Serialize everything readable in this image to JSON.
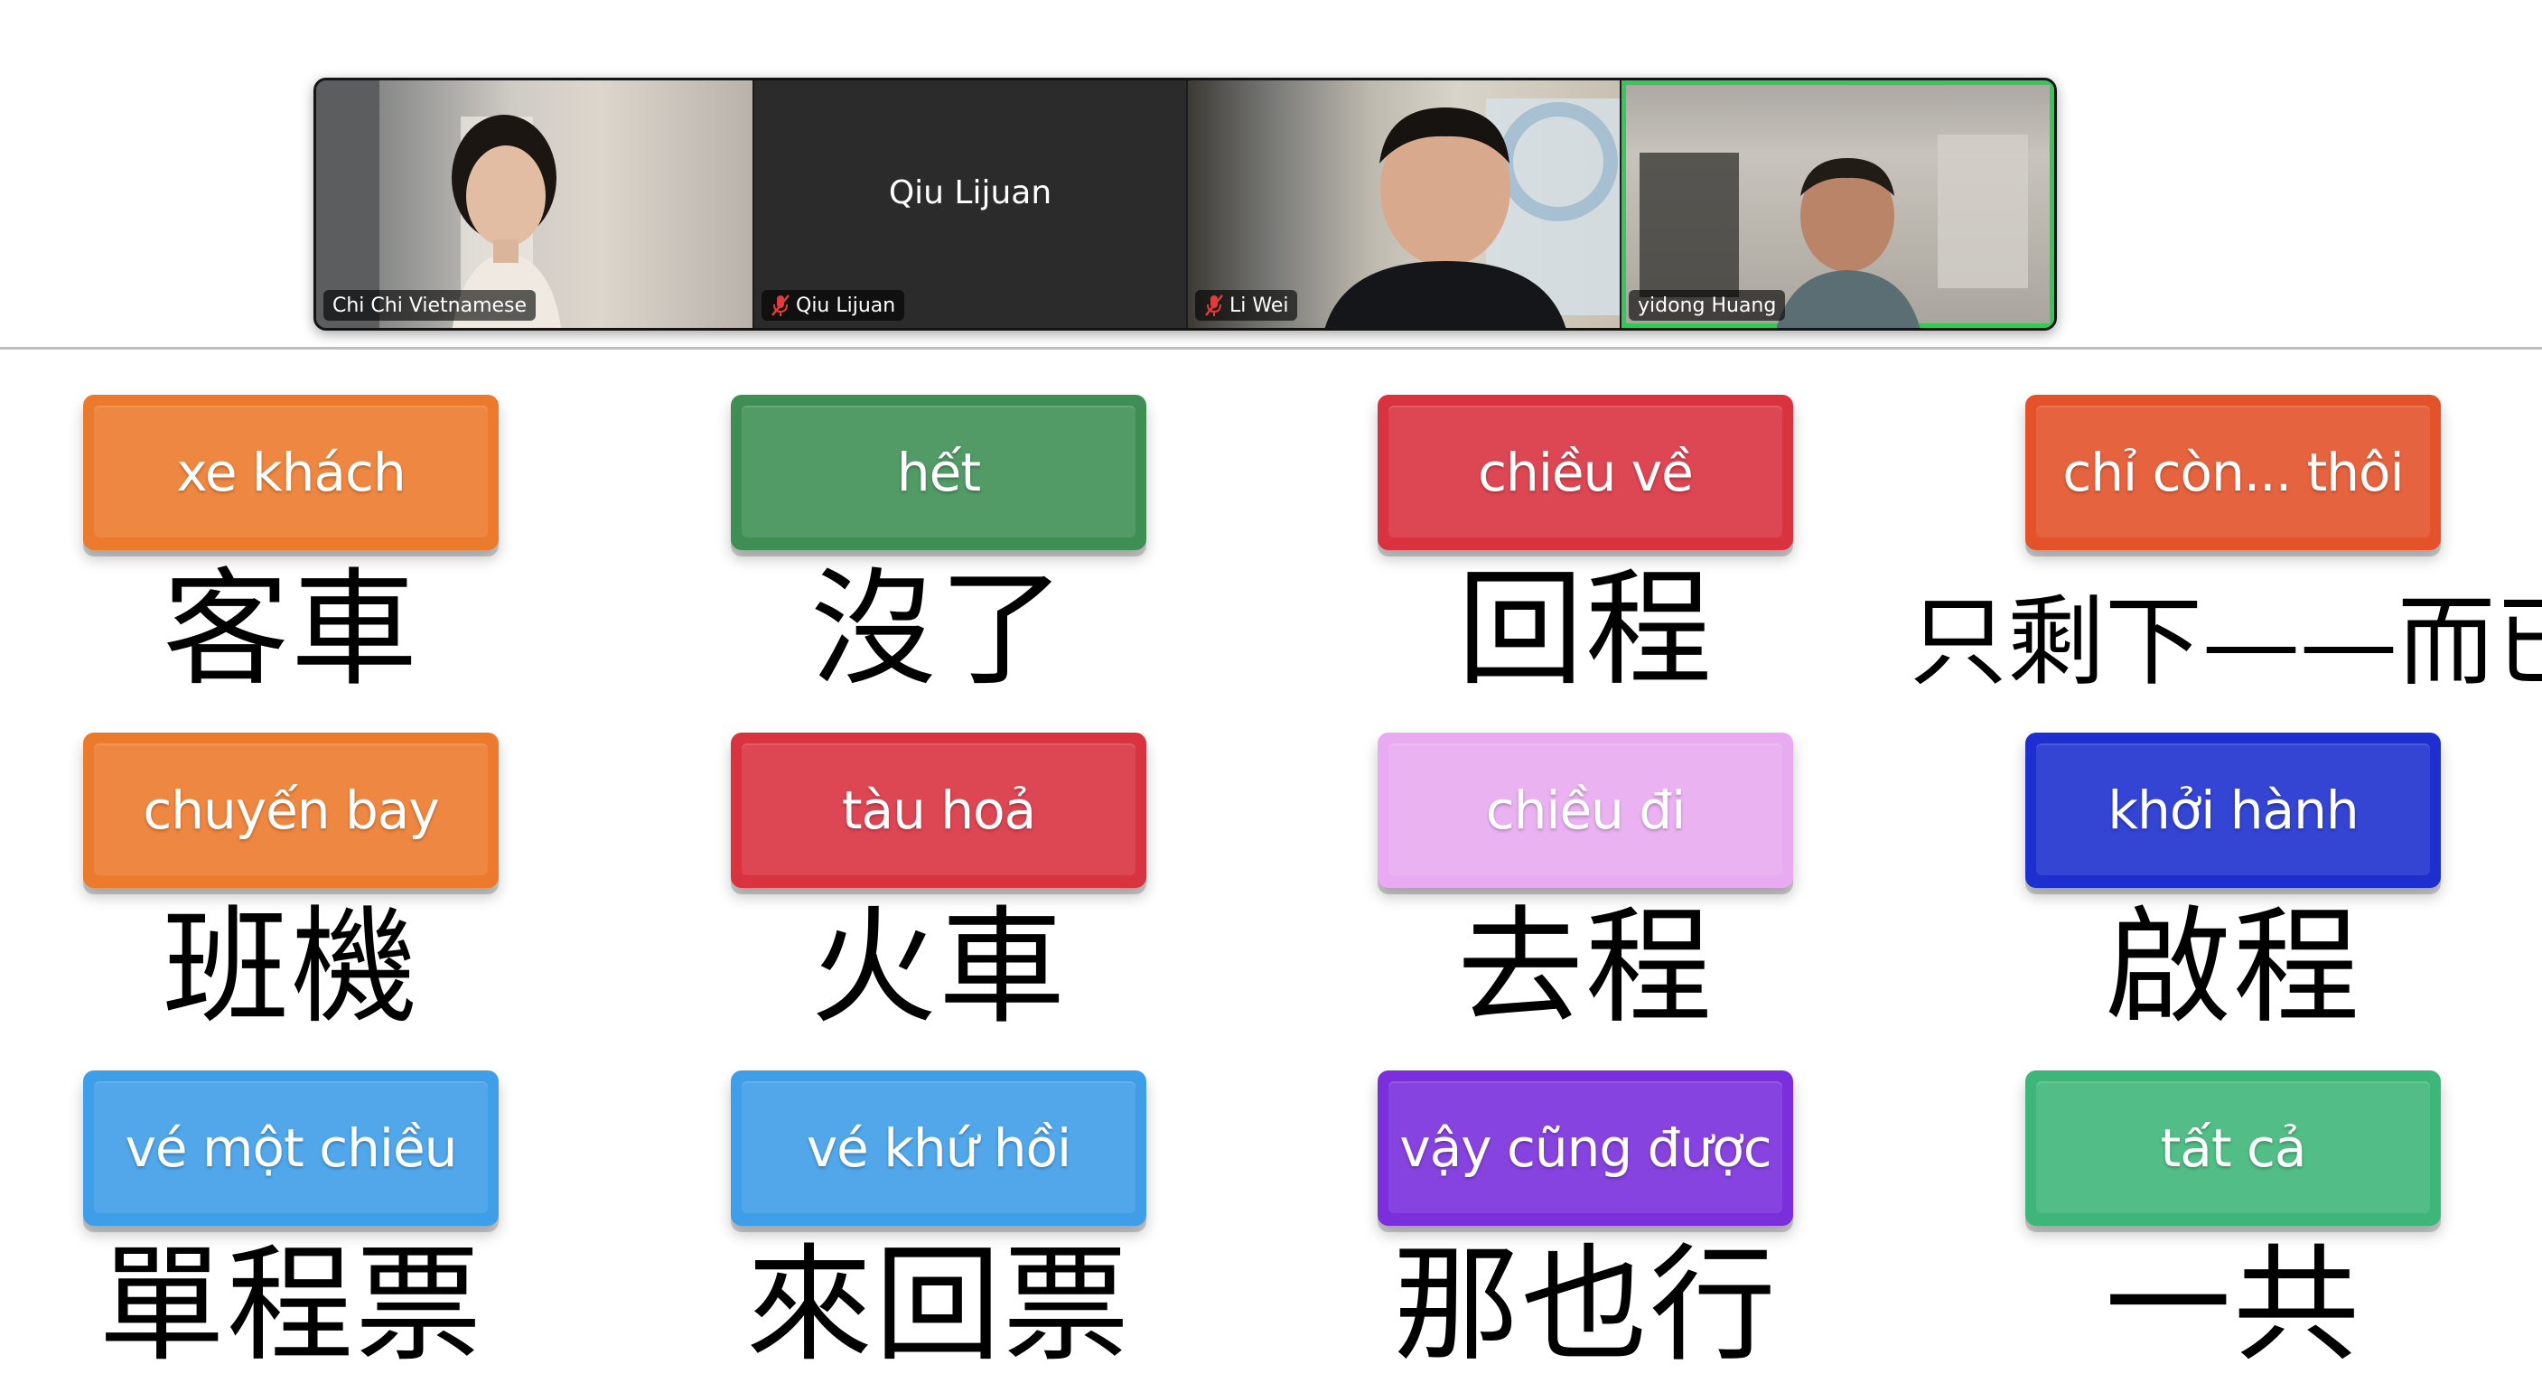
{
  "meeting": {
    "participants": [
      {
        "name_tag": "Chi Chi Vietnamese",
        "muted": false
      },
      {
        "name_tag": "Qiu Lijuan",
        "display_name": "Qiu Lijuan",
        "muted": true
      },
      {
        "name_tag": "Li Wei",
        "muted": true
      },
      {
        "name_tag": "yidong Huang",
        "muted": false,
        "active_speaker": true
      }
    ]
  },
  "cards": [
    {
      "vn": "xe khách",
      "zh": "客車",
      "color": "#ec7a2c"
    },
    {
      "vn": "hết",
      "zh": "沒了",
      "color": "#3f8f55"
    },
    {
      "vn": "chiều về",
      "zh": "回程",
      "color": "#d93340"
    },
    {
      "vn": "chỉ còn... thôi",
      "zh": "只剩下——而已",
      "color": "#e4522a"
    },
    {
      "vn": "chuyến bay",
      "zh": "班機",
      "color": "#ec7a2c"
    },
    {
      "vn": "tàu hoả",
      "zh": "火車",
      "color": "#d93340"
    },
    {
      "vn": "chiều đi",
      "zh": "去程",
      "color": "#e8aaf0"
    },
    {
      "vn": "khởi hành",
      "zh": "啟程",
      "color": "#1d2fcf"
    },
    {
      "vn": "vé một chiều",
      "zh": "單程票",
      "color": "#3e9ee8"
    },
    {
      "vn": "vé khứ hồi",
      "zh": "來回票",
      "color": "#3e9ee8"
    },
    {
      "vn": "vậy cũng được",
      "zh": "那也行",
      "color": "#7a2edc"
    },
    {
      "vn": "tất cả",
      "zh": "一共",
      "color": "#3fb679"
    }
  ]
}
